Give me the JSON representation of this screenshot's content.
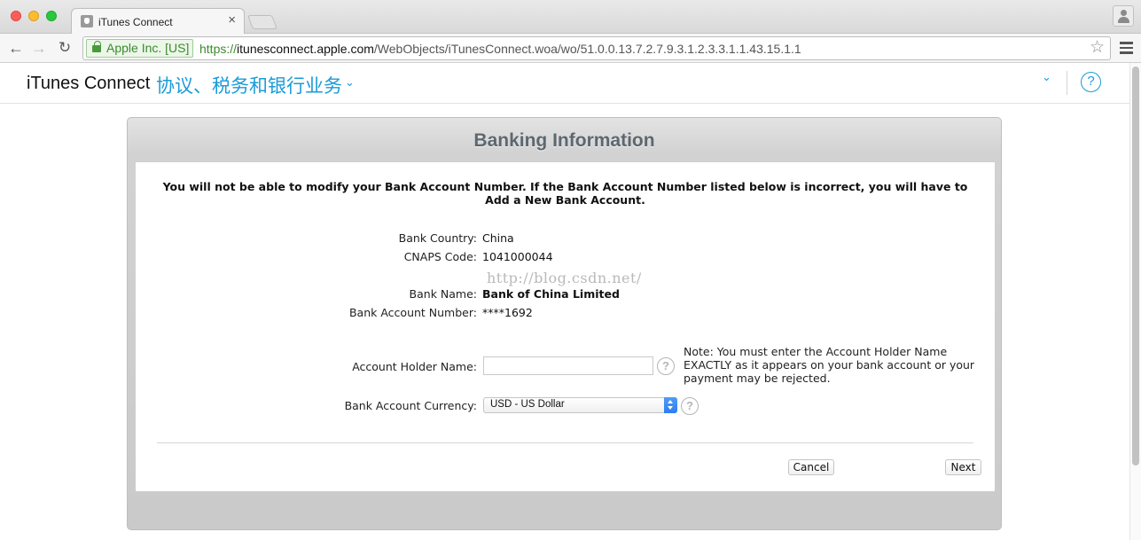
{
  "browser": {
    "tab_title": "iTunes Connect",
    "tab_close": "×",
    "ev_label": "Apple Inc. [US]",
    "url_scheme": "https://",
    "url_host": "itunesconnect.apple.com",
    "url_path": "/WebObjects/iTunesConnect.woa/wo/51.0.0.13.7.2.7.9.3.1.2.3.3.1.1.43.15.1.1"
  },
  "header": {
    "brand": "iTunes Connect",
    "section": "协议、税务和银行业务",
    "section_chevron": "⌄",
    "help": "?"
  },
  "panel": {
    "title": "Banking Information",
    "warning": "You will not be able to modify your Bank Account Number. If the Bank Account Number listed below is incorrect, you will have to Add a New Bank Account.",
    "fields": {
      "country_label": "Bank Country:",
      "country_value": "China",
      "cnaps_label": "CNAPS Code:",
      "cnaps_value": "1041000044",
      "bank_name_label": "Bank Name:",
      "bank_name_value": "Bank of China Limited",
      "account_number_label": "Bank Account Number:",
      "account_number_value": "****1692",
      "holder_label": "Account Holder Name:",
      "holder_value": "",
      "currency_label": "Bank Account Currency:",
      "currency_value": "USD - US Dollar"
    },
    "note": "Note: You must enter the Account Holder Name EXACTLY as it appears on your bank account or your payment may be rejected.",
    "watermark": "http://blog.csdn.net/",
    "help_glyph": "?",
    "cancel_label": "Cancel",
    "next_label": "Next"
  },
  "colors": {
    "accent": "#1a9bd7",
    "ev_green": "#3c8a2e",
    "title_gray": "#5d6770"
  }
}
